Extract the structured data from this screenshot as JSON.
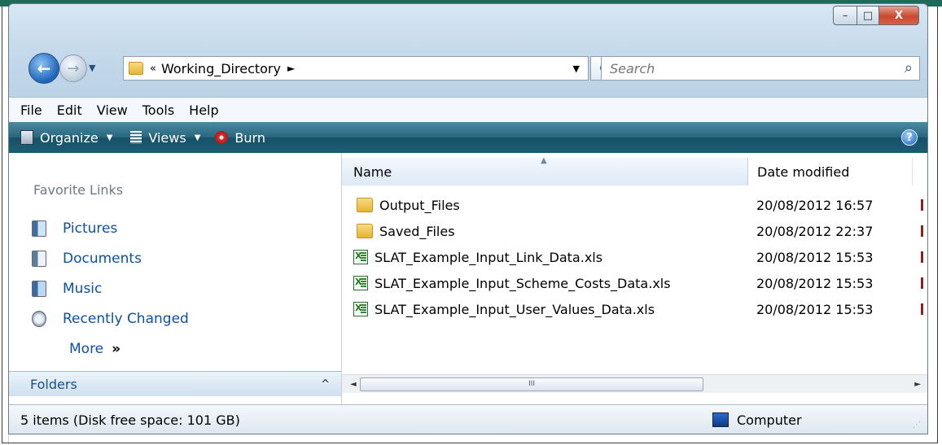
{
  "window": {
    "caption_buttons": {
      "minimize": "–",
      "maximize": "□",
      "close": "X"
    }
  },
  "nav": {
    "back_icon": "back-arrow-icon",
    "forward_icon": "forward-arrow-icon",
    "breadcrumb_prefix": "«",
    "current_folder": "Working_Directory",
    "breadcrumb_arrow": "►",
    "dropdown": "▼",
    "refresh_icon": "↺",
    "search_placeholder": "Search",
    "search_icon": "⌕"
  },
  "menu": {
    "items": [
      "File",
      "Edit",
      "View",
      "Tools",
      "Help"
    ]
  },
  "command_bar": {
    "organize": "Organize",
    "views": "Views",
    "burn": "Burn",
    "dropdown": "▼",
    "help": "?"
  },
  "nav_pane": {
    "favorites_title": "Favorite Links",
    "favorites": [
      {
        "label": "Pictures",
        "icon": "pictures-icon"
      },
      {
        "label": "Documents",
        "icon": "documents-icon"
      },
      {
        "label": "Music",
        "icon": "music-icon"
      },
      {
        "label": "Recently Changed",
        "icon": "recently-changed-icon"
      }
    ],
    "more": "More",
    "more_arrow": "»",
    "folders": "Folders",
    "folders_toggle": "^"
  },
  "file_list": {
    "columns": {
      "name": "Name",
      "date": "Date modified"
    },
    "sort_arrow": "▲",
    "rows": [
      {
        "name": "Output_Files",
        "date": "20/08/2012 16:57",
        "type": "folder"
      },
      {
        "name": "Saved_Files",
        "date": "20/08/2012 22:37",
        "type": "folder"
      },
      {
        "name": "SLAT_Example_Input_Link_Data.xls",
        "date": "20/08/2012 15:53",
        "type": "xls"
      },
      {
        "name": "SLAT_Example_Input_Scheme_Costs_Data.xls",
        "date": "20/08/2012 15:53",
        "type": "xls"
      },
      {
        "name": "SLAT_Example_Input_User_Values_Data.xls",
        "date": "20/08/2012 15:53",
        "type": "xls"
      }
    ],
    "scroll": {
      "left": "◄",
      "right": "►",
      "thumb": "III"
    }
  },
  "status": {
    "items_text": "5 items (Disk free space: 101 GB)",
    "location": "Computer"
  }
}
